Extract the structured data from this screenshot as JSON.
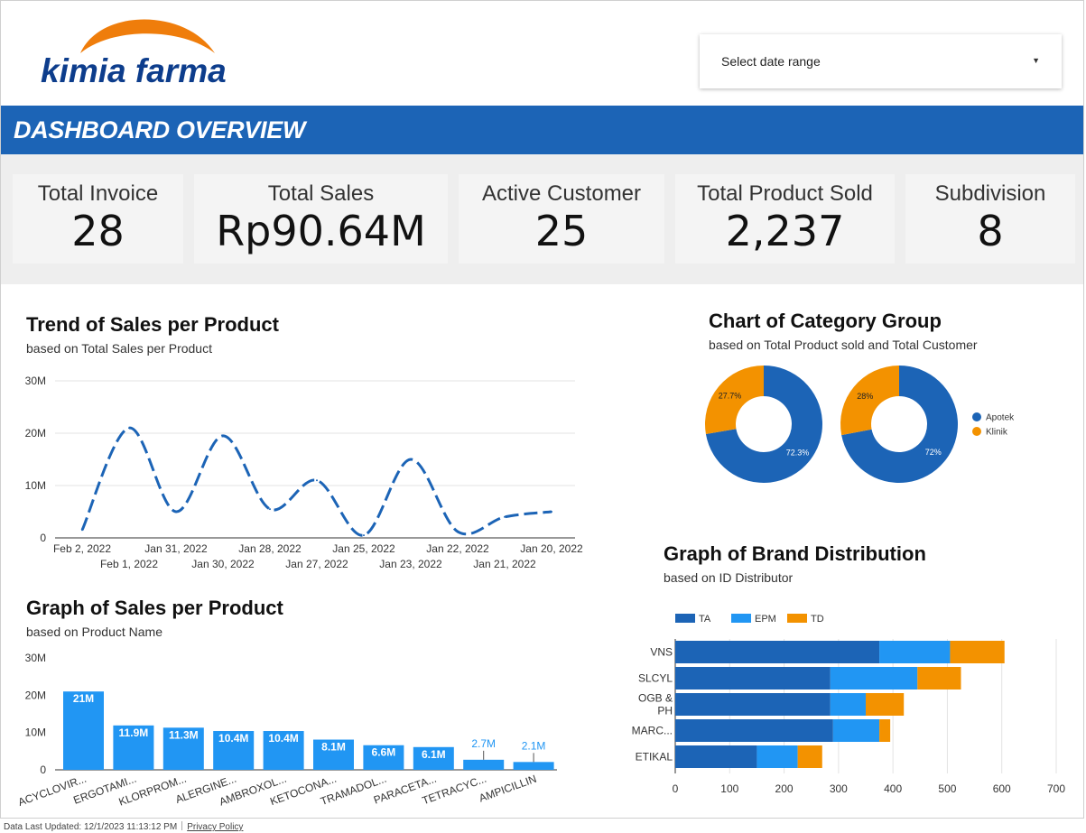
{
  "brand": {
    "logo_text": "kimia farma",
    "orange": "#ef7d0b",
    "navy": "#0d3d8c"
  },
  "date_picker": {
    "label": "Select date range"
  },
  "header": {
    "title": "DASHBOARD OVERVIEW"
  },
  "kpis": [
    {
      "label": "Total Invoice",
      "value": "28"
    },
    {
      "label": "Total Sales",
      "value": "Rp90.64M"
    },
    {
      "label": "Active Customer",
      "value": "25"
    },
    {
      "label": "Total Product Sold",
      "value": "2,237"
    },
    {
      "label": "Subdivision",
      "value": "8"
    }
  ],
  "trend": {
    "title": "Trend of Sales per Product",
    "subtitle": "based on Total Sales per Product"
  },
  "category": {
    "title": "Chart of Category Group",
    "subtitle": "based on Total Product sold and Total Customer"
  },
  "sales_product": {
    "title": "Graph of Sales per Product",
    "subtitle": "based on Product Name"
  },
  "brand_dist": {
    "title": "Graph of Brand Distribution",
    "subtitle": "based on ID Distributor"
  },
  "footer": {
    "updated": "Data Last Updated: 12/1/2023 11:13:12 PM",
    "privacy": "Privacy Policy"
  },
  "colors": {
    "blue_dark": "#1c64b6",
    "blue_light": "#2196f3",
    "orange": "#f39200",
    "banner": "#1c64b6"
  },
  "chart_data": [
    {
      "id": "trend",
      "type": "line",
      "x": [
        "Feb 2, 2022",
        "Feb 1, 2022",
        "Jan 31, 2022",
        "Jan 30, 2022",
        "Jan 28, 2022",
        "Jan 27, 2022",
        "Jan 25, 2022",
        "Jan 23, 2022",
        "Jan 22, 2022",
        "Jan 21, 2022",
        "Jan 20, 2022"
      ],
      "series": [
        {
          "values": [
            1.5,
            21,
            5,
            19.5,
            5.5,
            11,
            0.5,
            15,
            1.2,
            4,
            5
          ]
        }
      ],
      "ylim": [
        0,
        30
      ],
      "yticks": [
        0,
        10,
        20,
        30
      ],
      "ytick_labels": [
        "0",
        "10M",
        "20M",
        "30M"
      ],
      "line_style": "dashed",
      "grid": true
    },
    {
      "id": "category_pie_1",
      "type": "pie",
      "donut": true,
      "labels": [
        "Apotek",
        "Klinik"
      ],
      "values": [
        72.3,
        27.7
      ],
      "value_labels": [
        "72.3%",
        "27.7%"
      ],
      "colors": [
        "#1c64b6",
        "#f39200"
      ]
    },
    {
      "id": "category_pie_2",
      "type": "pie",
      "donut": true,
      "labels": [
        "Apotek",
        "Klinik"
      ],
      "values": [
        72,
        28
      ],
      "value_labels": [
        "72%",
        "28%"
      ],
      "colors": [
        "#1c64b6",
        "#f39200"
      ],
      "legend": [
        "Apotek",
        "Klinik"
      ],
      "legend_position": "right"
    },
    {
      "id": "sales_product",
      "type": "bar",
      "categories": [
        "ACYCLOVIR...",
        "ERGOTAMI...",
        "KLORPROM...",
        "ALERGINE...",
        "AMBROXOL...",
        "KETOCONA...",
        "TRAMADOL...",
        "PARACETA...",
        "TETRACYC...",
        "AMPICILLIN"
      ],
      "values": [
        21,
        11.9,
        11.3,
        10.4,
        10.4,
        8.1,
        6.6,
        6.1,
        2.7,
        2.1
      ],
      "value_labels": [
        "21M",
        "11.9M",
        "11.3M",
        "10.4M",
        "10.4M",
        "8.1M",
        "6.6M",
        "6.1M",
        "2.7M",
        "2.1M"
      ],
      "ylim": [
        0,
        30
      ],
      "yticks": [
        0,
        10,
        20,
        30
      ],
      "ytick_labels": [
        "0",
        "10M",
        "20M",
        "30M"
      ],
      "color": "#2196f3"
    },
    {
      "id": "brand_dist",
      "type": "bar",
      "orientation": "horizontal",
      "stacked": true,
      "categories": [
        "VNS",
        "SLCYL",
        "OGB & PH",
        "MARC...",
        "ETIKAL"
      ],
      "series": [
        {
          "name": "TA",
          "values": [
            375,
            285,
            285,
            290,
            150
          ],
          "color": "#1c64b6"
        },
        {
          "name": "EPM",
          "values": [
            130,
            160,
            65,
            85,
            75
          ],
          "color": "#2196f3"
        },
        {
          "name": "TD",
          "values": [
            100,
            80,
            70,
            20,
            45
          ],
          "color": "#f39200"
        }
      ],
      "xlim": [
        0,
        700
      ],
      "xticks": [
        0,
        100,
        200,
        300,
        400,
        500,
        600,
        700
      ],
      "legend_position": "top-left"
    }
  ]
}
